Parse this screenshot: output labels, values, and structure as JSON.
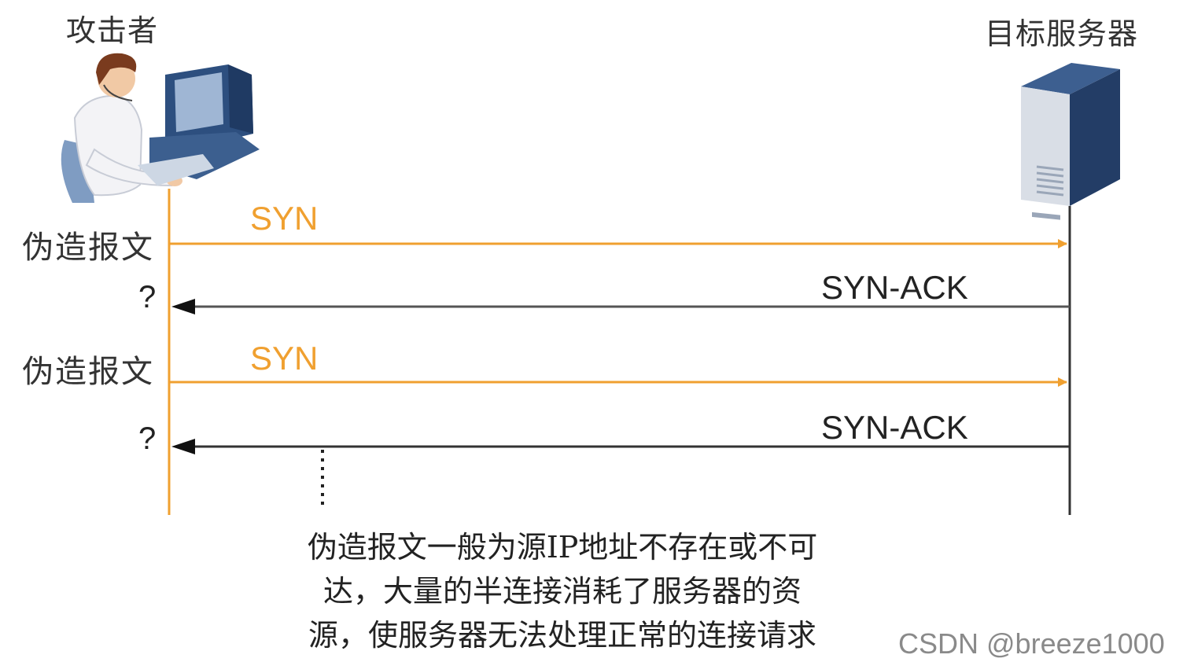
{
  "attacker": {
    "label": "攻击者"
  },
  "server": {
    "label": "目标服务器"
  },
  "messages": [
    {
      "side_label": "伪造报文",
      "text": "SYN"
    },
    {
      "side_label": "?",
      "text": "SYN-ACK"
    },
    {
      "side_label": "伪造报文",
      "text": "SYN"
    },
    {
      "side_label": "?",
      "text": "SYN-ACK"
    }
  ],
  "note": {
    "lines": [
      "伪造报文一般为源IP地址不存在或不可",
      "达，大量的半连接消耗了服务器的资",
      "源，使服务器无法处理正常的连接请求"
    ]
  },
  "watermark": "CSDN @breeze1000",
  "colors": {
    "orange": "#f0a030",
    "dark": "#333333"
  },
  "icons": {
    "attacker": "person-at-computer-icon",
    "server": "server-tower-icon"
  }
}
